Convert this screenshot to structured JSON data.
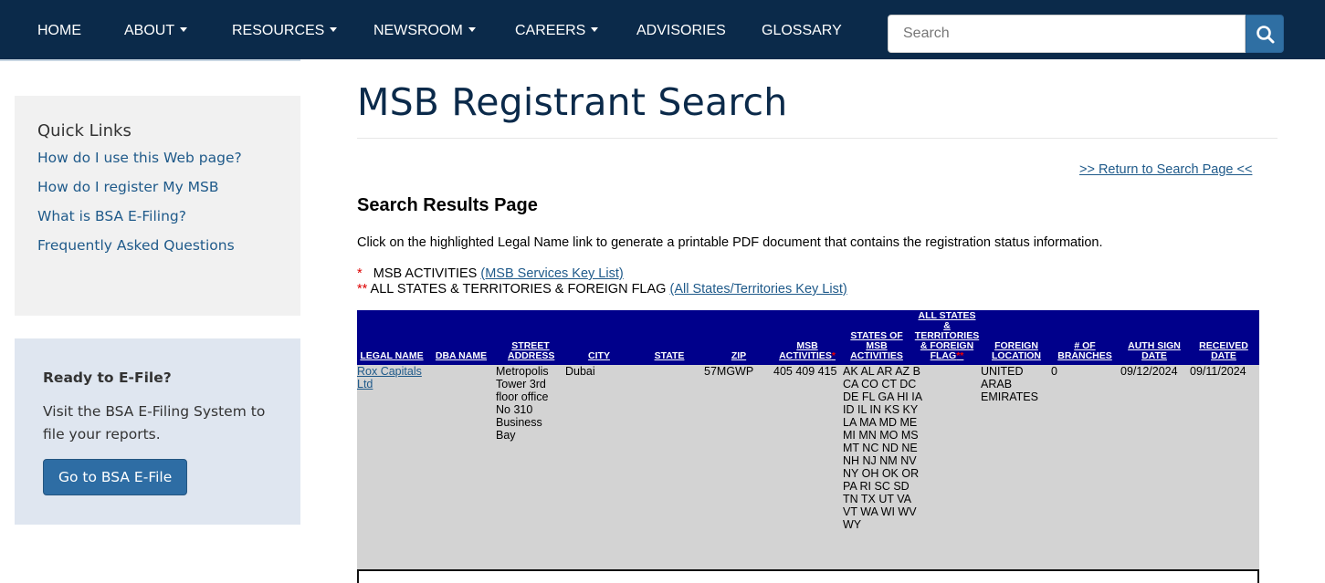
{
  "nav": {
    "home": "HOME",
    "about": "ABOUT",
    "resources": "RESOURCES",
    "newsroom": "NEWSROOM",
    "careers": "CAREERS",
    "advisories": "ADVISORIES",
    "glossary": "GLOSSARY",
    "search_placeholder": "Search"
  },
  "sidebar": {
    "quick_links_title": "Quick Links",
    "links": [
      "How do I use this Web page?",
      "How do I register My MSB",
      "What is BSA E-Filing?",
      "Frequently Asked Questions"
    ],
    "efile": {
      "title": "Ready to E-File?",
      "text": "Visit the BSA E-Filing System to file your reports.",
      "button": "Go to BSA E-File"
    }
  },
  "main": {
    "title": "MSB Registrant Search",
    "return_link": ">> Return to Search Page <<",
    "results_heading": "Search Results Page",
    "instructions": "Click on the highlighted Legal Name link to generate a printable PDF document that contains the registration status information.",
    "legend1_mark": "*",
    "legend1_text": "MSB ACTIVITIES",
    "legend1_link": "(MSB Services Key List)",
    "legend2_mark": "**",
    "legend2_text": "ALL STATES & TERRITORIES & FOREIGN FLAG",
    "legend2_link": "(All States/Territories Key List)"
  },
  "table": {
    "headers": {
      "legal_name": "LEGAL NAME",
      "dba_name": "DBA NAME",
      "street_address": "STREET ADDRESS",
      "city": "CITY",
      "state": "STATE",
      "zip": "ZIP",
      "msb_activities": "MSB ACTIVITIES",
      "states_of_msb": "STATES OF MSB ACTIVITIES",
      "all_states": "ALL STATES & TERRITORIES & FOREIGN FLAG",
      "foreign_location": "FOREIGN LOCATION",
      "branches": "# OF BRANCHES",
      "auth_sign_date": "AUTH SIGN DATE",
      "received_date": "RECEIVED DATE"
    },
    "row": {
      "legal_name": "Rox Capitals Ltd",
      "dba_name": "",
      "street_address": "Metropolis Tower 3rd floor office No 310 Business Bay",
      "city": "Dubai",
      "state": "",
      "zip": "57MGWP",
      "msb_activities": "405 409 415",
      "states": "AK AL AR AZ B CA CO CT DC DE FL GA HI IA ID IL IN KS KY LA MA MD ME MI MN MO MS MT NC ND NE NH NJ NM NV NY OH OK OR PA RI SC SD TN TX UT VA VT WA WI WV WY",
      "all_states": "",
      "foreign_location": "UNITED ARAB EMIRATES",
      "branches": "0",
      "auth_sign_date": "09/12/2024",
      "received_date": "09/11/2024"
    }
  },
  "colors": {
    "navbar": "#0b2a4a",
    "table_header": "#00008b",
    "link": "#1f5a8a",
    "button": "#2e6da4"
  }
}
